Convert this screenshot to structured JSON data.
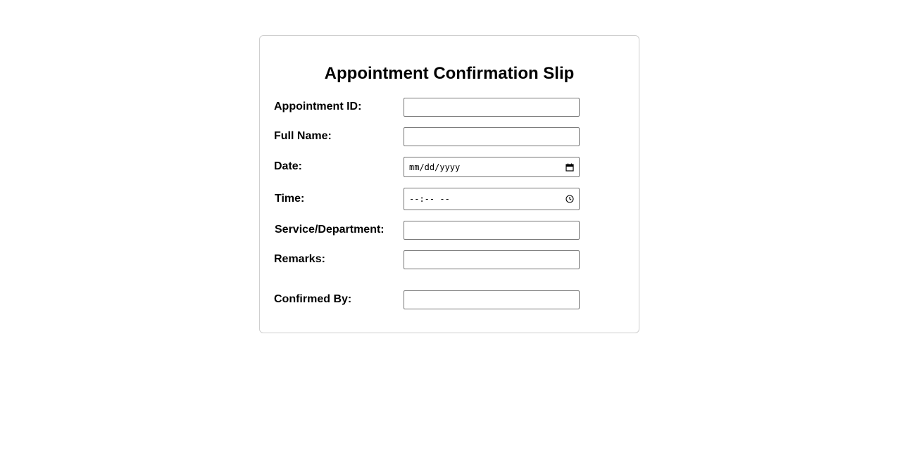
{
  "form": {
    "title": "Appointment Confirmation Slip",
    "fields": {
      "appointment_id": {
        "label": "Appointment ID:",
        "value": ""
      },
      "full_name": {
        "label": "Full Name:",
        "value": ""
      },
      "date": {
        "label": "Date:",
        "placeholder": "mm/dd/yyyy"
      },
      "time": {
        "label": "Time:",
        "placeholder": "--:-- --"
      },
      "service_department": {
        "label": "Service/Department:",
        "value": ""
      },
      "remarks": {
        "label": "Remarks:",
        "value": ""
      },
      "confirmed_by": {
        "label": "Confirmed By:",
        "value": ""
      }
    },
    "icons": {
      "date": "calendar-icon",
      "time": "clock-icon"
    }
  }
}
